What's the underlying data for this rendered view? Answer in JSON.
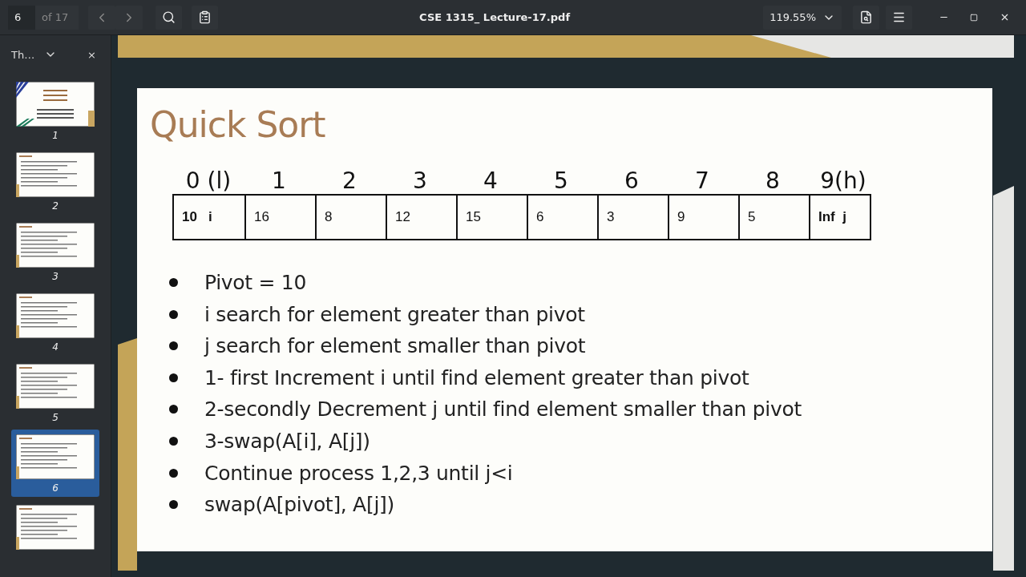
{
  "toolbar": {
    "page_number": "6",
    "page_count": "of 17",
    "title": "CSE 1315_ Lecture-17.pdf",
    "zoom": "119.55%"
  },
  "sidebar": {
    "view_label": "Th…",
    "close": "×",
    "thumbnails": [
      {
        "kind": "title",
        "label": "1",
        "selected": false
      },
      {
        "kind": "content",
        "label": "2",
        "selected": false
      },
      {
        "kind": "content",
        "label": "3",
        "selected": false
      },
      {
        "kind": "content",
        "label": "4",
        "selected": false
      },
      {
        "kind": "content",
        "label": "5",
        "selected": false
      },
      {
        "kind": "content",
        "label": "6",
        "selected": true
      },
      {
        "kind": "content",
        "selected": false
      }
    ]
  },
  "slide": {
    "title": "Quick Sort",
    "indices": [
      "0 (l)",
      "1",
      "2",
      "3",
      "4",
      "5",
      "6",
      "7",
      "8",
      "9(h)"
    ],
    "cells": [
      {
        "value": "10   i",
        "bold": true
      },
      {
        "value": "16",
        "bold": false
      },
      {
        "value": "8",
        "bold": false
      },
      {
        "value": "12",
        "bold": false
      },
      {
        "value": "15",
        "bold": false
      },
      {
        "value": "6",
        "bold": false
      },
      {
        "value": "3",
        "bold": false
      },
      {
        "value": "9",
        "bold": false
      },
      {
        "value": "5",
        "bold": false
      },
      {
        "value": "Inf  j",
        "bold": true
      }
    ],
    "bullets": [
      "Pivot = 10",
      "i search for element greater than pivot",
      "j search for element smaller than pivot",
      "1- first Increment i until find element greater than pivot",
      "2-secondly Decrement j until find element smaller than pivot",
      "3-swap(A[i], A[j])",
      "Continue process 1,2,3 until j<i",
      "swap(A[pivot], A[j])"
    ]
  }
}
